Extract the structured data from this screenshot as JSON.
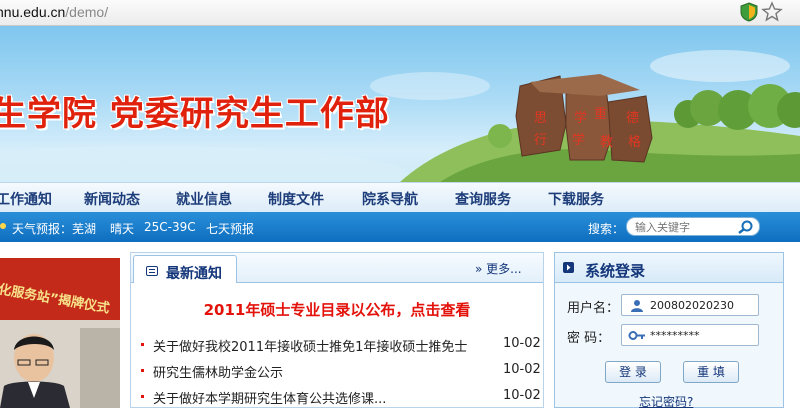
{
  "browser": {
    "url_host": "nnu.edu.cn",
    "url_path": "/demo/",
    "icons": [
      "shield-icon",
      "bookmark-star-icon"
    ]
  },
  "banner": {
    "title": "生学院 党委研究生工作部",
    "rock_characters": [
      "思",
      "学",
      "重",
      "德",
      "行",
      "学",
      "教",
      "格"
    ],
    "colors": {
      "title": "#e0220c",
      "sky": "#a9daf5",
      "grass": "#7ab84a"
    }
  },
  "nav": {
    "items": [
      "工作通知",
      "新闻动态",
      "就业信息",
      "制度文件",
      "院系导航",
      "查询服务",
      "下载服务"
    ]
  },
  "infobar": {
    "weather_label": "天气预报：芜湖",
    "weather": "晴天",
    "temperature": "25C-39C",
    "forecast_link": "七天预报",
    "search_label": "搜索：",
    "search_placeholder": "输入关键字",
    "colors": {
      "bar": "#0e6ec0"
    }
  },
  "photo": {
    "banner_text": "化服务站”揭牌仪式"
  },
  "news": {
    "title": "最新通知",
    "more": "更多...",
    "headline": "2011年硕士专业目录以公布，点击查看",
    "rows": [
      {
        "text": "关于做好我校2011年接收硕士推免1年接收硕士推免士",
        "date": "10-02"
      },
      {
        "text": "研究生儒林助学金公示",
        "date": "10-02"
      },
      {
        "text": "关于做好本学期研究生体育公共选修课...",
        "date": "10-02"
      }
    ]
  },
  "login": {
    "title": "系统登录",
    "username_label": "用户名：",
    "username_value": "200802020230",
    "password_label": "密  码：",
    "password_value": "*********",
    "login_button": "登 录",
    "reset_button": "重 填",
    "forgot": "忘记密码?"
  }
}
